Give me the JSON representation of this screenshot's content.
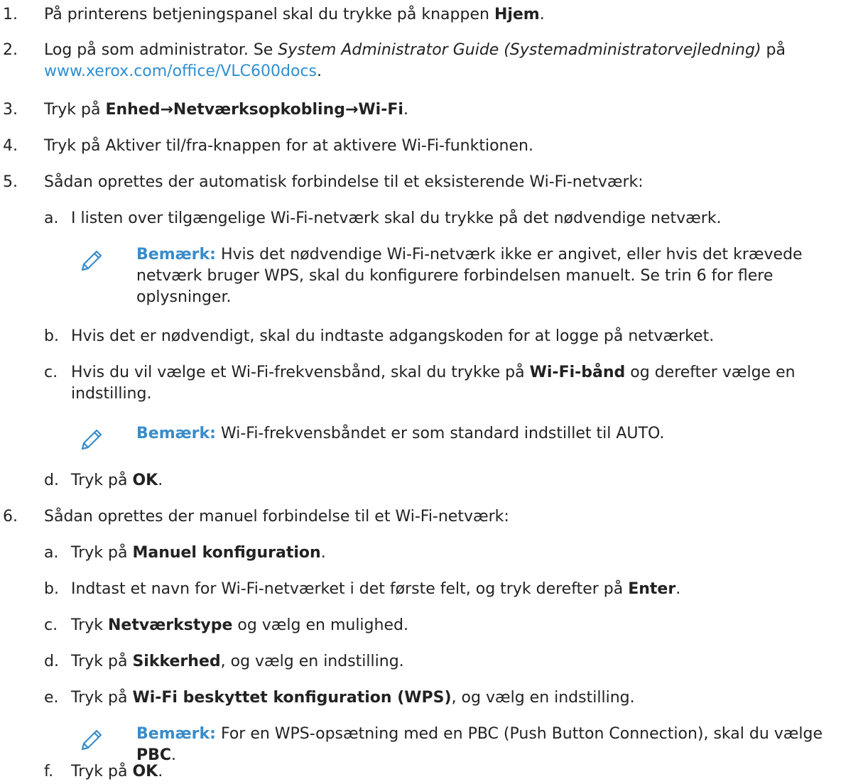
{
  "steps": {
    "s1": {
      "num": "1.",
      "pre": "På printerens betjeningspanel skal du trykke på knappen ",
      "bold": "Hjem",
      "post": "."
    },
    "s2": {
      "num": "2.",
      "pre": "Log på som administrator. Se ",
      "italic": "System Administrator Guide (Systemadministratorvejledning)",
      "mid": " på",
      "link": "www.xerox.com/office/VLC600docs",
      "post": "."
    },
    "s3": {
      "num": "3.",
      "pre": "Tryk på ",
      "bold": "Enhed→Netværksopkobling→Wi-Fi",
      "post": "."
    },
    "s4": {
      "num": "4.",
      "text": "Tryk på Aktiver til/fra-knappen for at aktivere Wi-Fi-funktionen."
    },
    "s5": {
      "num": "5.",
      "text": "Sådan oprettes der automatisk forbindelse til et eksisterende Wi-Fi-netværk:",
      "a": {
        "num": "a.",
        "text": "I listen over tilgængelige Wi-Fi-netværk skal du trykke på det nødvendige netværk."
      },
      "note1": {
        "label": "Bemærk:",
        "text": " Hvis det nødvendige Wi-Fi-netværk ikke er angivet, eller hvis det krævede netværk bruger WPS, skal du konfigurere forbindelsen manuelt. Se trin 6 for flere oplysninger."
      },
      "b": {
        "num": "b.",
        "text": "Hvis det er nødvendigt, skal du indtaste adgangskoden for at logge på netværket."
      },
      "c": {
        "num": "c.",
        "pre": "Hvis du vil vælge et Wi-Fi-frekvensbånd, skal du trykke på ",
        "bold": "Wi-Fi-bånd",
        "post": " og derefter vælge en indstilling."
      },
      "note2": {
        "label": "Bemærk:",
        "text": " Wi-Fi-frekvensbåndet er som standard indstillet til AUTO."
      },
      "d": {
        "num": "d.",
        "pre": "Tryk på ",
        "bold": "OK",
        "post": "."
      }
    },
    "s6": {
      "num": "6.",
      "text": "Sådan oprettes der manuel forbindelse til et Wi-Fi-netværk:",
      "a": {
        "num": "a.",
        "pre": "Tryk på ",
        "bold": "Manuel konfiguration",
        "post": "."
      },
      "b": {
        "num": "b.",
        "pre": "Indtast et navn for Wi-Fi-netværket i det første felt, og tryk derefter på ",
        "bold": "Enter",
        "post": "."
      },
      "c": {
        "num": "c.",
        "pre": "Tryk ",
        "bold": "Netværkstype",
        "post": " og vælg en mulighed."
      },
      "d": {
        "num": "d.",
        "pre": "Tryk på ",
        "bold": "Sikkerhed",
        "post": ", og vælg en indstilling."
      },
      "e": {
        "num": "e.",
        "pre": "Tryk på ",
        "bold": "Wi-Fi beskyttet konfiguration (WPS)",
        "post": ", og vælg en indstilling."
      },
      "note3": {
        "label": "Bemærk:",
        "pre": " For en WPS-opsætning med en PBC (Push Button Connection), skal du vælge ",
        "bold": "PBC",
        "post": "."
      },
      "f": {
        "num": "f.",
        "pre": "Tryk på ",
        "bold": "OK",
        "post": "."
      }
    }
  },
  "icons": {
    "note": "pencil-icon"
  },
  "colors": {
    "note_label": "#3a8cc9",
    "link": "#2f8fd0",
    "text": "#222222"
  }
}
